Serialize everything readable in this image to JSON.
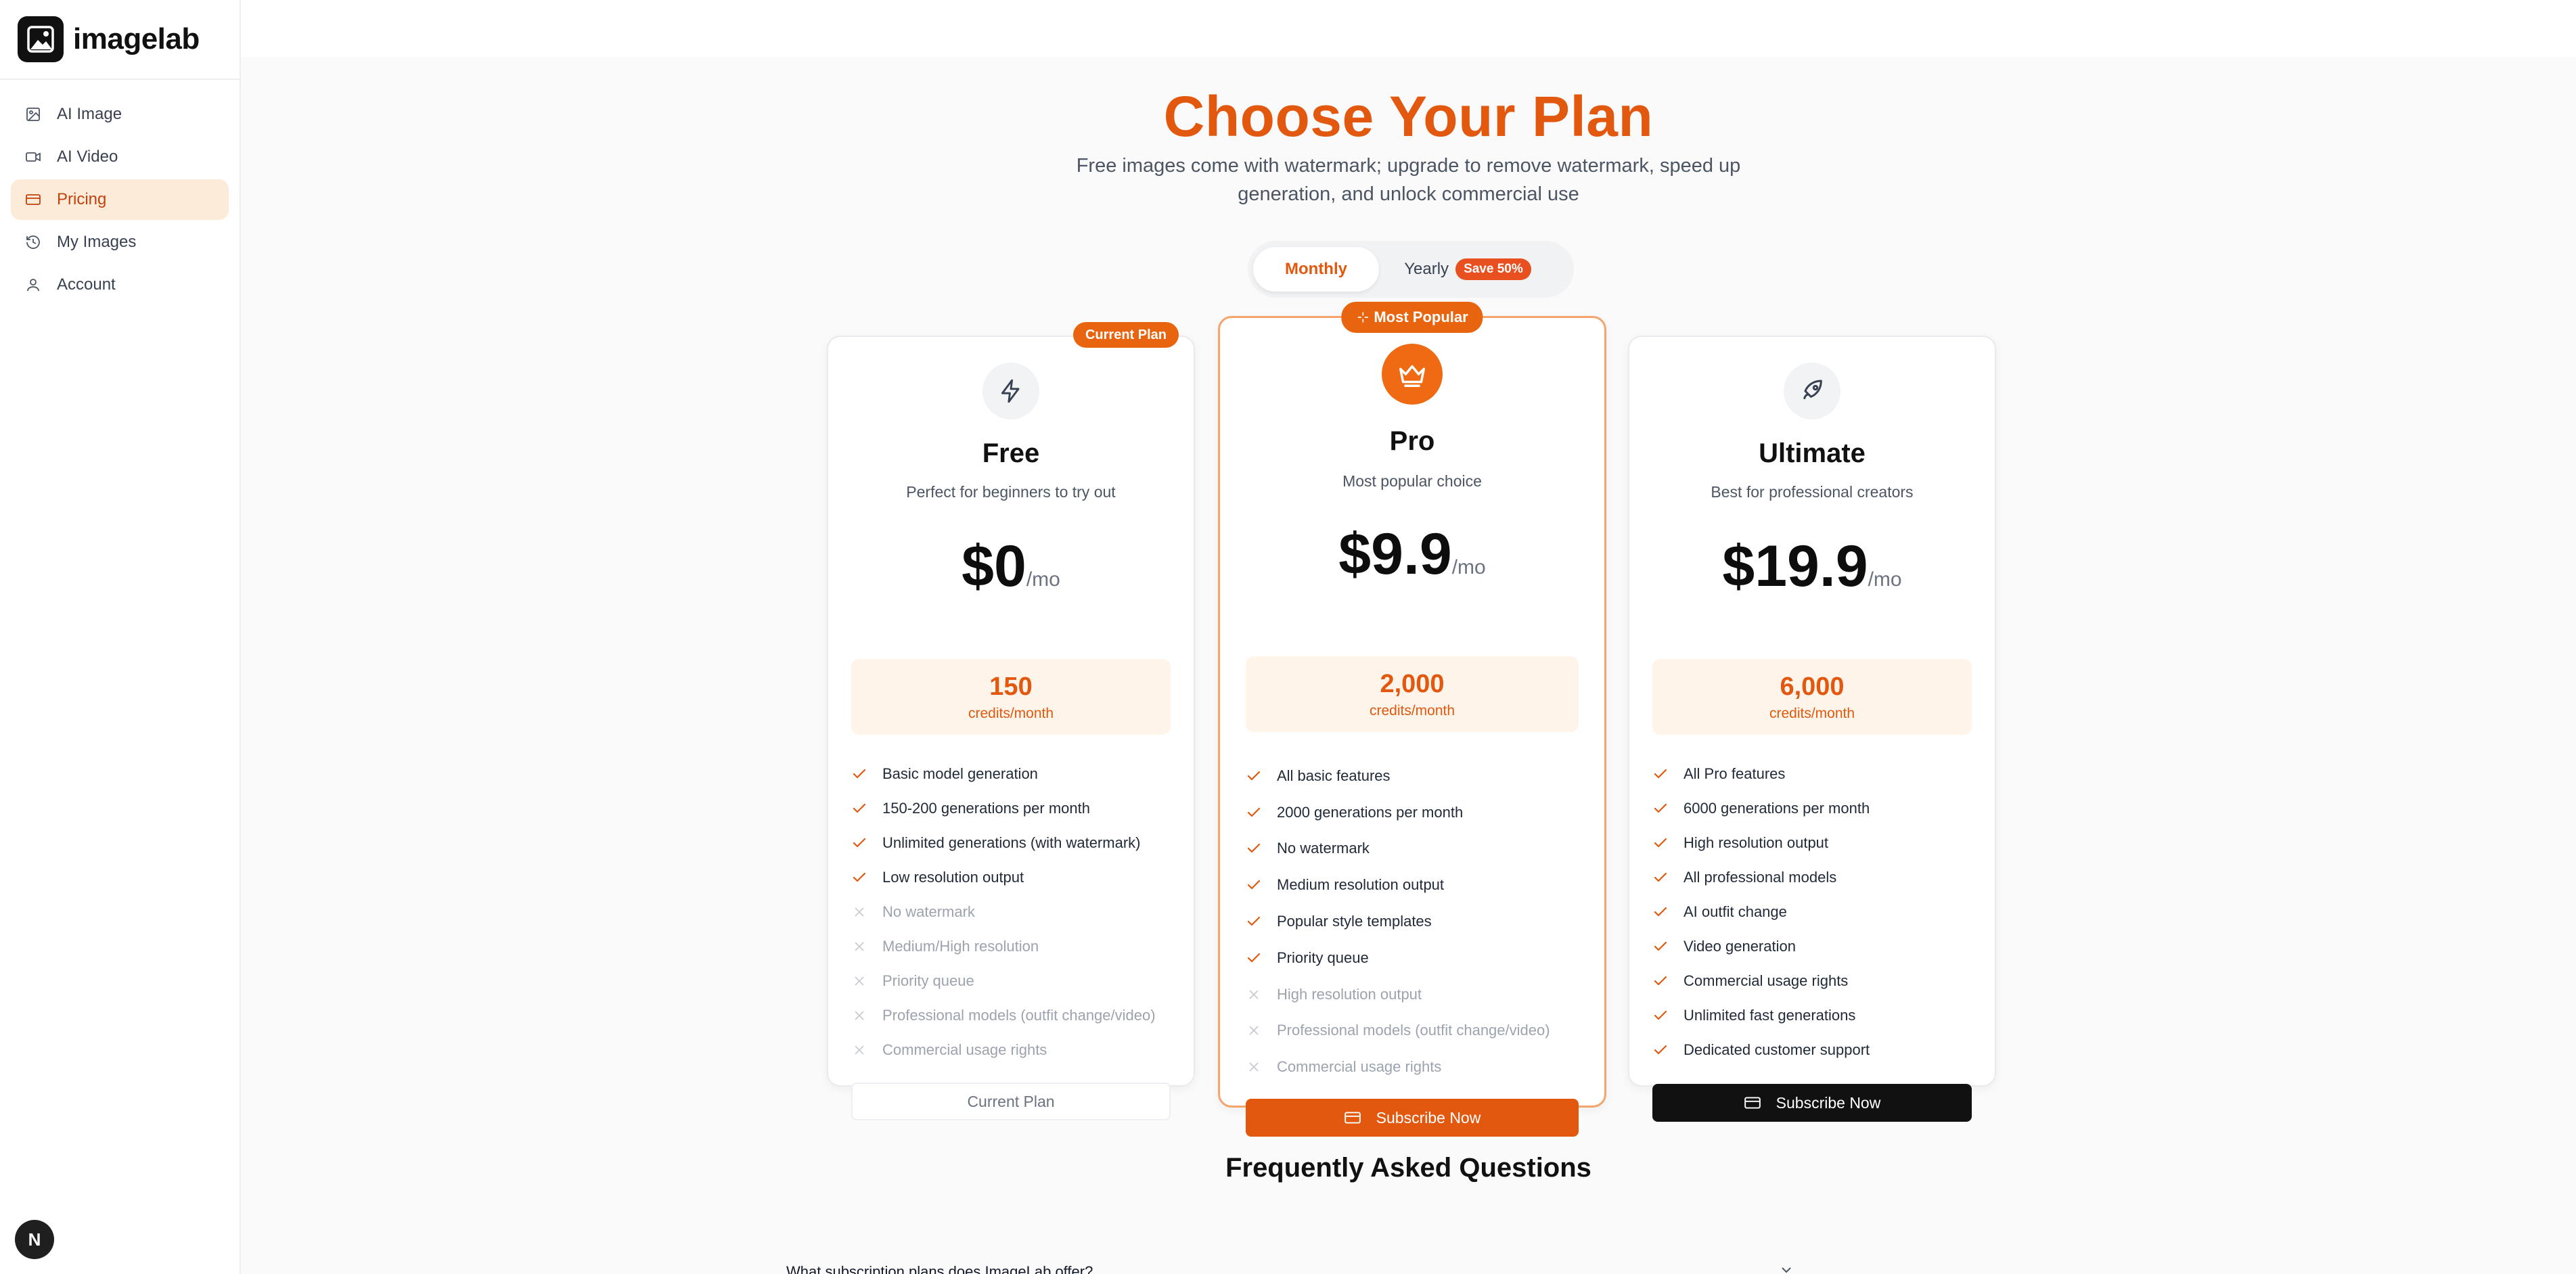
{
  "app": {
    "name": "imagelab"
  },
  "sidebar": {
    "items": [
      {
        "label": "AI Image",
        "icon": "image-icon"
      },
      {
        "label": "AI Video",
        "icon": "video-icon"
      },
      {
        "label": "Pricing",
        "icon": "credit-card-icon",
        "active": true
      },
      {
        "label": "My Images",
        "icon": "history-icon"
      },
      {
        "label": "Account",
        "icon": "user-icon"
      }
    ],
    "avatar_letter": "N"
  },
  "header": {
    "title": "Choose Your Plan",
    "subtitle": "Free images come with watermark; upgrade to remove watermark, speed up generation, and unlock commercial use"
  },
  "billing_toggle": {
    "monthly": "Monthly",
    "yearly": "Yearly",
    "save_badge": "Save 50%",
    "selected": "Monthly"
  },
  "plans": [
    {
      "ribbon": "Current Plan",
      "icon": "lightning-icon",
      "name": "Free",
      "description": "Perfect for beginners to try out",
      "price": "$0",
      "period": "/mo",
      "credits": "150",
      "credits_label": "credits/month",
      "features": [
        {
          "text": "Basic model generation",
          "included": true
        },
        {
          "text": "150-200 generations per month",
          "included": true
        },
        {
          "text": "Unlimited generations (with watermark)",
          "included": true
        },
        {
          "text": "Low resolution output",
          "included": true
        },
        {
          "text": "No watermark",
          "included": false
        },
        {
          "text": "Medium/High resolution",
          "included": false
        },
        {
          "text": "Priority queue",
          "included": false
        },
        {
          "text": "Professional models (outfit change/video)",
          "included": false
        },
        {
          "text": "Commercial usage rights",
          "included": false
        }
      ],
      "button": "Current Plan"
    },
    {
      "ribbon": "Most Popular",
      "icon": "crown-icon",
      "name": "Pro",
      "description": "Most popular choice",
      "price": "$9.9",
      "period": "/mo",
      "credits": "2,000",
      "credits_label": "credits/month",
      "features": [
        {
          "text": "All basic features",
          "included": true
        },
        {
          "text": "2000 generations per month",
          "included": true
        },
        {
          "text": "No watermark",
          "included": true
        },
        {
          "text": "Medium resolution output",
          "included": true
        },
        {
          "text": "Popular style templates",
          "included": true
        },
        {
          "text": "Priority queue",
          "included": true
        },
        {
          "text": "High resolution output",
          "included": false
        },
        {
          "text": "Professional models (outfit change/video)",
          "included": false
        },
        {
          "text": "Commercial usage rights",
          "included": false
        }
      ],
      "button": "Subscribe Now"
    },
    {
      "icon": "rocket-icon",
      "name": "Ultimate",
      "description": "Best for professional creators",
      "price": "$19.9",
      "period": "/mo",
      "credits": "6,000",
      "credits_label": "credits/month",
      "features": [
        {
          "text": "All Pro features",
          "included": true
        },
        {
          "text": "6000 generations per month",
          "included": true
        },
        {
          "text": "High resolution output",
          "included": true
        },
        {
          "text": "All professional models",
          "included": true
        },
        {
          "text": "AI outfit change",
          "included": true
        },
        {
          "text": "Video generation",
          "included": true
        },
        {
          "text": "Commercial usage rights",
          "included": true
        },
        {
          "text": "Unlimited fast generations",
          "included": true
        },
        {
          "text": "Dedicated customer support",
          "included": true
        }
      ],
      "button": "Subscribe Now"
    }
  ],
  "faq": {
    "title": "Frequently Asked Questions",
    "items": [
      {
        "question": "What subscription plans does ImageLab offer?"
      }
    ]
  },
  "colors": {
    "accent": "#e2580e",
    "accent_light": "#fff4ea",
    "dark_button": "#111111"
  }
}
